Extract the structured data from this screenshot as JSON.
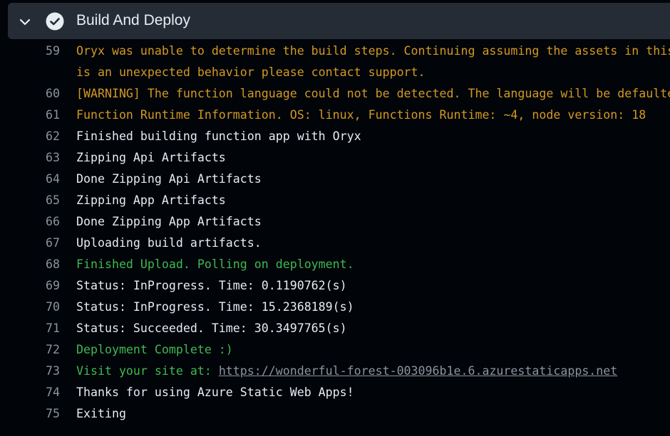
{
  "step": {
    "title": "Build And Deploy",
    "status": "succeeded"
  },
  "log": {
    "lines": [
      {
        "num": "59",
        "text": "Oryx was unable to determine the build steps. Continuing assuming the assets in this",
        "tone": "warn"
      },
      {
        "num": "",
        "text": "is an unexpected behavior please contact support.",
        "tone": "warn"
      },
      {
        "num": "60",
        "text": "[WARNING] The function language could not be detected. The language will be defaulted",
        "tone": "warn"
      },
      {
        "num": "61",
        "text": "Function Runtime Information. OS: linux, Functions Runtime: ~4, node version: 18",
        "tone": "warn"
      },
      {
        "num": "62",
        "text": "Finished building function app with Oryx",
        "tone": "normal"
      },
      {
        "num": "63",
        "text": "Zipping Api Artifacts",
        "tone": "normal"
      },
      {
        "num": "64",
        "text": "Done Zipping Api Artifacts",
        "tone": "normal"
      },
      {
        "num": "65",
        "text": "Zipping App Artifacts",
        "tone": "normal"
      },
      {
        "num": "66",
        "text": "Done Zipping App Artifacts",
        "tone": "normal"
      },
      {
        "num": "67",
        "text": "Uploading build artifacts.",
        "tone": "normal"
      },
      {
        "num": "68",
        "text": "Finished Upload. Polling on deployment.",
        "tone": "ok"
      },
      {
        "num": "69",
        "text": "Status: InProgress. Time: 0.1190762(s)",
        "tone": "normal"
      },
      {
        "num": "70",
        "text": "Status: InProgress. Time: 15.2368189(s)",
        "tone": "normal"
      },
      {
        "num": "71",
        "text": "Status: Succeeded. Time: 30.3497765(s)",
        "tone": "normal"
      },
      {
        "num": "72",
        "text": "Deployment Complete :)",
        "tone": "ok"
      },
      {
        "num": "73",
        "text": "Visit your site at: ",
        "link": "https://wonderful-forest-003096b1e.6.azurestaticapps.net",
        "tone": "ok"
      },
      {
        "num": "74",
        "text": "Thanks for using Azure Static Web Apps!",
        "tone": "normal"
      },
      {
        "num": "75",
        "text": "Exiting",
        "tone": "normal"
      }
    ]
  },
  "colors": {
    "header_bg": "#262c36",
    "warn": "#d29922",
    "success": "#3fb950",
    "text": "#e6edf3",
    "line_number": "#8b949e"
  },
  "icons": {
    "expand": "chevron-down-icon",
    "status": "check-circle-icon"
  }
}
